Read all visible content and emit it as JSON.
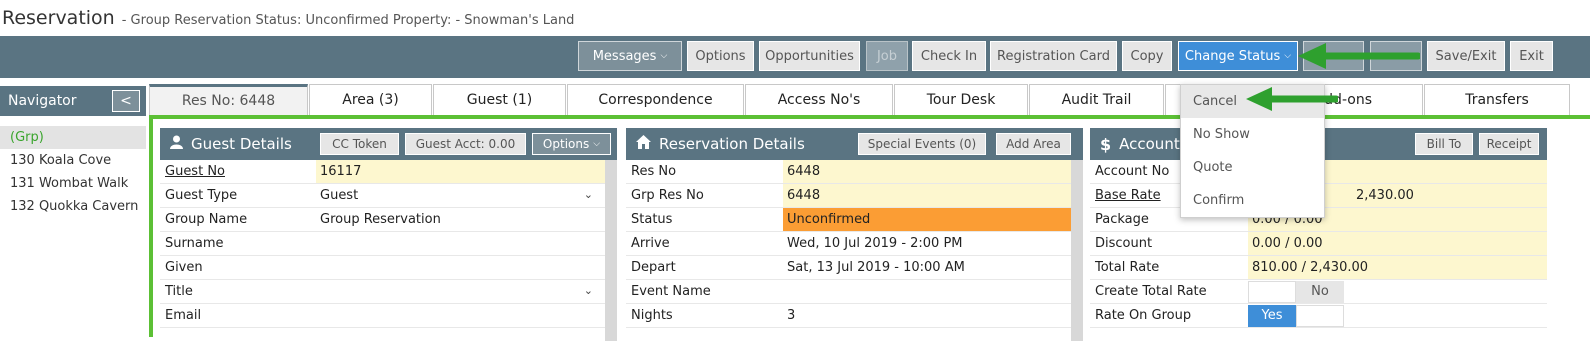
{
  "header": {
    "title": "Reservation",
    "subtitle": "- Group Reservation   Status: Unconfirmed Property: - Snowman's Land"
  },
  "toolbar": {
    "messages": "Messages",
    "options": "Options",
    "opportunities": "Opportunities",
    "job": "Job",
    "check_in": "Check In",
    "registration_card": "Registration Card",
    "copy": "Copy",
    "change_status": "Change Status",
    "save_exit": "Save/Exit",
    "exit": "Exit"
  },
  "navigator": {
    "title": "Navigator",
    "collapse_glyph": "<",
    "items": [
      "(Grp)",
      "130 Koala Cove",
      "131 Wombat Walk",
      "132 Quokka Cavern"
    ]
  },
  "tabs": [
    "Res No: 6448",
    "Area (3)",
    "Guest (1)",
    "Correspondence",
    "Access No's",
    "Tour Desk",
    "Audit Trail",
    "Add-ons",
    "Transfers"
  ],
  "tabs_partial": {
    "addons_visible": "Add-ons"
  },
  "guest_details": {
    "title": "Guest Details",
    "cc_token": "CC Token",
    "guest_acct": "Guest Acct: 0.00",
    "options": "Options",
    "rows": [
      {
        "label": "Guest No",
        "value": "16117"
      },
      {
        "label": "Guest Type",
        "value": "Guest"
      },
      {
        "label": "Group Name",
        "value": "Group Reservation"
      },
      {
        "label": "Surname",
        "value": ""
      },
      {
        "label": "Given",
        "value": ""
      },
      {
        "label": "Title",
        "value": ""
      },
      {
        "label": "Email",
        "value": ""
      }
    ]
  },
  "reservation_details": {
    "title": "Reservation Details",
    "special_events": "Special Events (0)",
    "add_area": "Add Area",
    "rows": [
      {
        "label": "Res No",
        "value": "6448"
      },
      {
        "label": "Grp Res No",
        "value": "6448"
      },
      {
        "label": "Status",
        "value": "Unconfirmed"
      },
      {
        "label": "Arrive",
        "value": "Wed, 10 Jul 2019 - 2:00 PM"
      },
      {
        "label": "Depart",
        "value": "Sat, 13 Jul 2019 - 10:00 AM"
      },
      {
        "label": "Event Name",
        "value": ""
      },
      {
        "label": "Nights",
        "value": "3"
      }
    ]
  },
  "account": {
    "title": "Account",
    "bill_to": "Bill To",
    "receipt": "Receipt",
    "rows": [
      {
        "label": "Account No",
        "value": ""
      },
      {
        "label": "Base Rate",
        "value": "2,430.00"
      },
      {
        "label": "Package",
        "value": "0.00 / 0.00"
      },
      {
        "label": "Discount",
        "value": "0.00 / 0.00"
      },
      {
        "label": "Total Rate",
        "value": "810.00 / 2,430.00"
      },
      {
        "label": "Create Total Rate",
        "value": "No"
      },
      {
        "label": "Rate On Group",
        "value": "Yes"
      }
    ]
  },
  "status_menu": {
    "items": [
      "Cancel",
      "No Show",
      "Quote",
      "Confirm"
    ]
  },
  "colors": {
    "toolbar": "#5a7482",
    "highlight_border": "#5cc035",
    "status_orange": "#fb9d34",
    "field_yellow": "#fdf7cf",
    "annotation_arrow": "#2ea02e",
    "active_button": "#3e8ed8"
  },
  "icons": {
    "guest_details": "user-icon",
    "reservation_details": "home-icon",
    "account": "dollar-icon",
    "dropdown": "chevron-down-icon"
  }
}
